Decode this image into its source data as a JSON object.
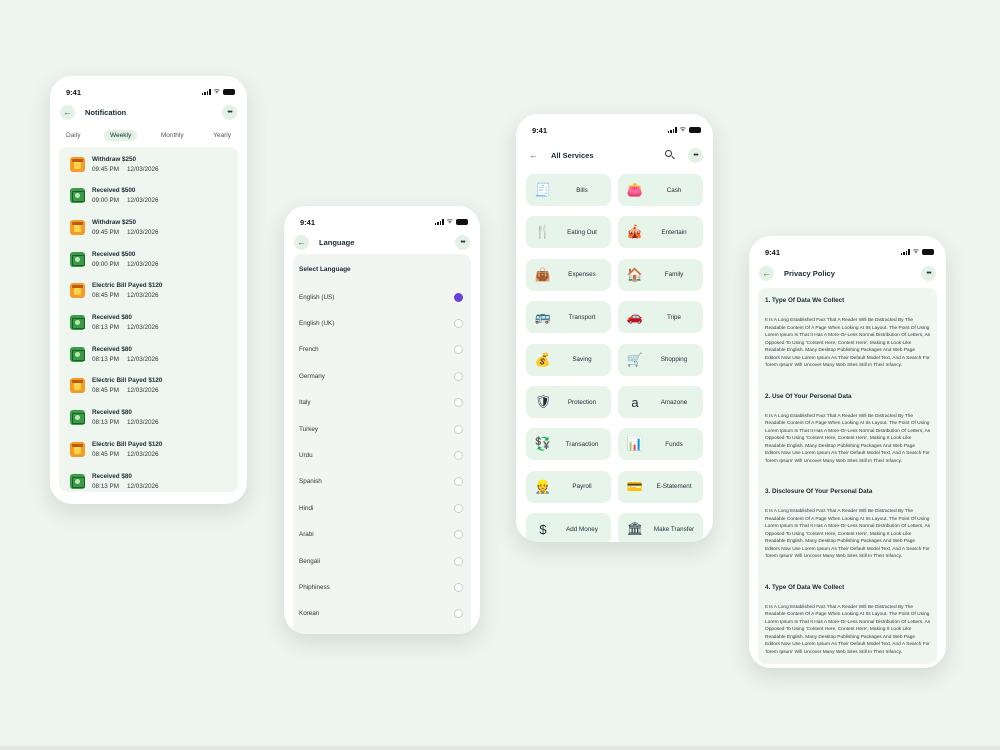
{
  "colors": {
    "background": "#eef4ef",
    "accent_green": "#e3f1e6",
    "radio_selected": "#6a3fd6"
  },
  "status_time": "9:41",
  "notification": {
    "title": "Notification",
    "tabs": [
      "Daily",
      "Weekly",
      "Monthly",
      "Yearly"
    ],
    "active_tab": "Weekly",
    "items": [
      {
        "icon": "withdraw-icon",
        "title": "Withdraw $250",
        "time": "09:45 PM",
        "date": "12/03/2026"
      },
      {
        "icon": "received-icon",
        "title": "Received $500",
        "time": "09:00 PM",
        "date": "12/03/2026"
      },
      {
        "icon": "withdraw-icon",
        "title": "Withdraw $250",
        "time": "09:45 PM",
        "date": "12/03/2026"
      },
      {
        "icon": "received-icon",
        "title": "Received $500",
        "time": "09:00 PM",
        "date": "12/03/2026"
      },
      {
        "icon": "withdraw-icon",
        "title": "Electric Bill Payed  $120",
        "time": "08:45 PM",
        "date": "12/03/2026"
      },
      {
        "icon": "received-icon",
        "title": "Received $80",
        "time": "08:13 PM",
        "date": "12/03/2026"
      },
      {
        "icon": "received-icon",
        "title": "Received $80",
        "time": "08:13 PM",
        "date": "12/03/2026"
      },
      {
        "icon": "withdraw-icon",
        "title": "Electric Bill Payed  $120",
        "time": "08:45 PM",
        "date": "12/03/2026"
      },
      {
        "icon": "received-icon",
        "title": "Received $80",
        "time": "08:13 PM",
        "date": "12/03/2026"
      },
      {
        "icon": "withdraw-icon",
        "title": "Electric Bill Payed  $120",
        "time": "08:45 PM",
        "date": "12/03/2026"
      },
      {
        "icon": "received-icon",
        "title": "Received $80",
        "time": "08:13 PM",
        "date": "12/03/2026"
      }
    ]
  },
  "language": {
    "title": "Language",
    "section": "Select Language",
    "selected": "English (US)",
    "options": [
      "English (US)",
      "English (UK)",
      "French",
      "Germany",
      "Italy",
      "Turkey",
      "Urdu",
      "Spanish",
      "Hindi",
      "Arabi",
      "Bengali",
      "Phiphiness",
      "Korean"
    ]
  },
  "services": {
    "title": "All Services",
    "items": [
      {
        "label": "Bills",
        "icon": "bills-icon",
        "glyph": "🧾"
      },
      {
        "label": "Cash",
        "icon": "wallet-icon",
        "glyph": "👛"
      },
      {
        "label": "Eating Out",
        "icon": "fork-knife-icon",
        "glyph": "🍴"
      },
      {
        "label": "Entertain",
        "icon": "entertain-icon",
        "glyph": "🎪"
      },
      {
        "label": "Expenses",
        "icon": "expenses-icon",
        "glyph": "👜"
      },
      {
        "label": "Family",
        "icon": "family-icon",
        "glyph": "🏠"
      },
      {
        "label": "Transport",
        "icon": "bus-icon",
        "glyph": "🚌"
      },
      {
        "label": "Tripe",
        "icon": "car-icon",
        "glyph": "🚗"
      },
      {
        "label": "Saving",
        "icon": "saving-icon",
        "glyph": "💰"
      },
      {
        "label": "Shopping",
        "icon": "cart-icon",
        "glyph": "🛒"
      },
      {
        "label": "Protection",
        "icon": "shield-icon",
        "glyph": "🛡"
      },
      {
        "label": "Amazone",
        "icon": "amazon-icon",
        "glyph": "a"
      },
      {
        "label": "Transaction",
        "icon": "transaction-icon",
        "glyph": "💱"
      },
      {
        "label": "Funds",
        "icon": "funds-icon",
        "glyph": "📊"
      },
      {
        "label": "Payroll",
        "icon": "payroll-icon",
        "glyph": "👷"
      },
      {
        "label": "E-Statement",
        "icon": "statement-icon",
        "glyph": "💳"
      },
      {
        "label": "Add Money",
        "icon": "dollar-icon",
        "glyph": "$"
      },
      {
        "label": "Make Transfer",
        "icon": "bank-icon",
        "glyph": "🏛"
      }
    ]
  },
  "privacy": {
    "title": "Privacy Policy",
    "sections": [
      {
        "heading": "1.  Type Of Data We Collect",
        "body": "It Is A Long Established Fact That A Reader Will Be Distracted By The Readable Content Of A Page When Looking At Its Layout. The Point Of Using Lorem Ipsum Is That It Has A More-Or-Less Normal Distribution Of Letters, As Opposed To Using 'Content Here, Content Here', Making It Look Like Readable English. Many Desktop Publishing Packages And Web Page Editors Now Use Lorem Ipsum As Their Default Model Text, And A Search For 'lorem Ipsum' Will Uncover Many Web Sites Still In Their Infancy."
      },
      {
        "heading": "2.  Use Of Your Personal Data",
        "body": "It Is A Long Established Fact That A Reader Will Be Distracted By The Readable Content Of A Page When Looking At Its Layout. The Point Of Using Lorem Ipsum Is That It Has A More-Or-Less Normal Distribution Of Letters, As Opposed To Using 'Content Here, Content Here', Making It Look Like Readable English. Many Desktop Publishing Packages And Web Page Editors Now Use Lorem Ipsum As Their Default Model Text, And A Search For 'lorem Ipsum' Will Uncover Many Web Sites Still In Their Infancy."
      },
      {
        "heading": "3.  Disclosure Of Your Personal Data",
        "body": "It Is A Long Established Fact That A Reader Will Be Distracted By The Readable Content Of A Page When Looking At Its Layout. The Point Of Using Lorem Ipsum Is That It Has A More-Or-Less Normal Distribution Of Letters, As Opposed To Using 'Content Here, Content Here', Making It Look Like Readable English. Many Desktop Publishing Packages And Web Page Editors Now Use Lorem Ipsum As Their Default Model Text, And A Search For 'lorem Ipsum' Will Uncover Many Web Sites Still In Their Infancy."
      },
      {
        "heading": "4.  Type Of Data We Collect",
        "body": "It Is A Long Established Fact That A Reader Will Be Distracted By The Readable Content Of A Page When Looking At Its Layout. The Point Of Using Lorem Ipsum Is That It Has A More-Or-Less Normal Distribution Of Letters, As Opposed To Using 'Content Here, Content Here', Making It Look Like Readable English. Many Desktop Publishing Packages And Web Page Editors Now Use Lorem Ipsum As Their Default Model Text, And A Search For 'lorem Ipsum' Will Uncover Many Web Sites Still In Their Infancy."
      }
    ]
  }
}
